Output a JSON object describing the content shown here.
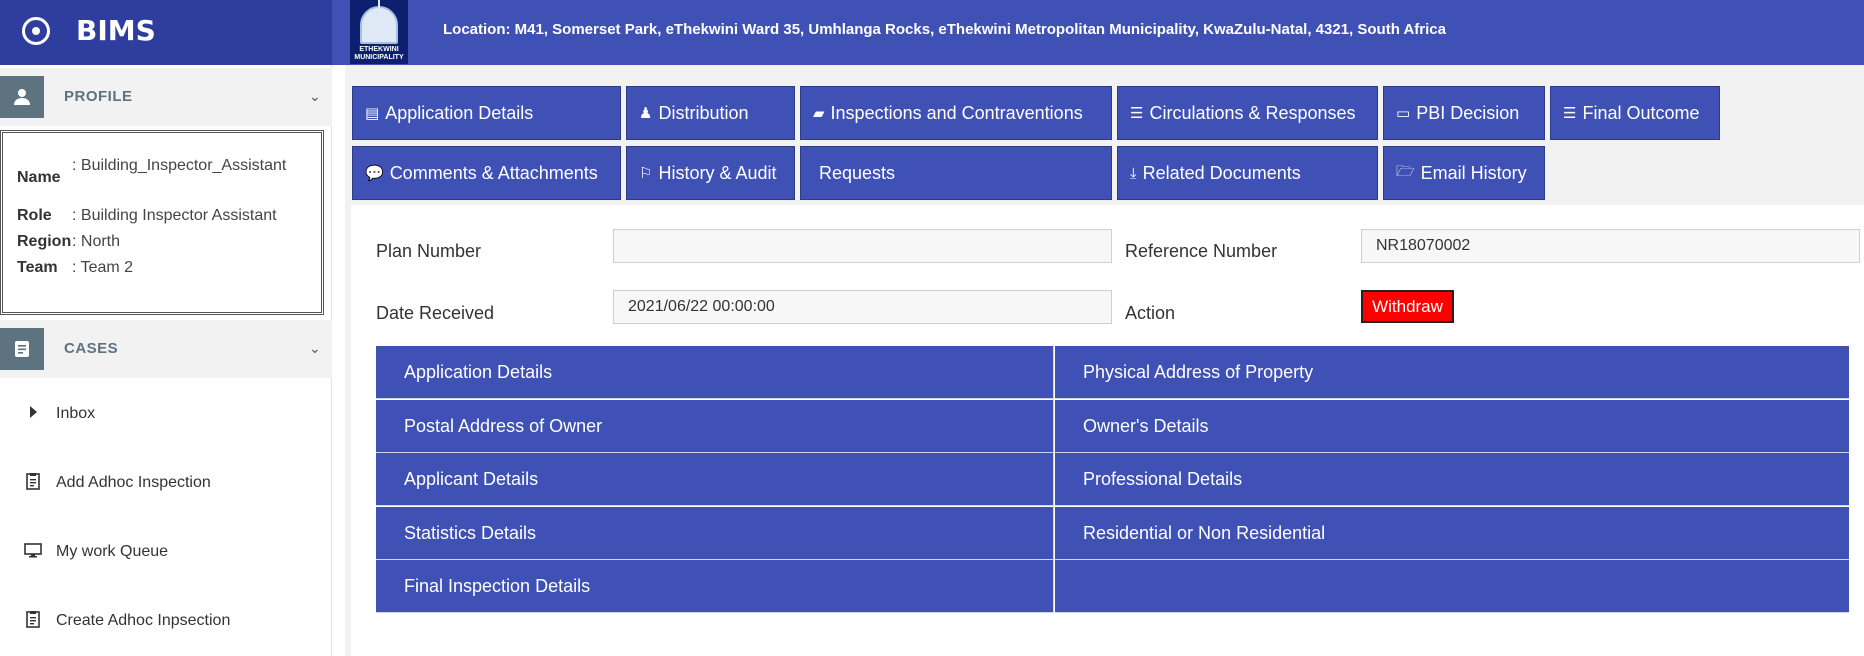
{
  "app": {
    "name": "BIMS"
  },
  "header": {
    "logo_text": "ETHEKWINI MUNICIPALITY",
    "location": "Location: M41, Somerset Park, eThekwini Ward 35, Umhlanga Rocks, eThekwini Metropolitan Municipality, KwaZulu-Natal, 4321, South Africa"
  },
  "sidebar": {
    "profile_title": "PROFILE",
    "profile": {
      "name_key": "Name",
      "name_val": ": Building_Inspector_Assistant",
      "role_key": "Role",
      "role_val": ": Building Inspector Assistant",
      "region_key": "Region",
      "region_val": ": North",
      "team_key": "Team",
      "team_val": ": Team 2"
    },
    "cases_title": "CASES",
    "items": [
      {
        "label": "Inbox",
        "icon": "caret-right-icon"
      },
      {
        "label": "Add Adhoc Inspection",
        "icon": "clipboard-icon"
      },
      {
        "label": "My work Queue",
        "icon": "monitor-icon"
      },
      {
        "label": "Create Adhoc Inpsection",
        "icon": "clipboard-icon"
      }
    ]
  },
  "tabs": [
    {
      "label": "Application Details",
      "icon": "id-card-icon",
      "glyph": "▤"
    },
    {
      "label": "Distribution",
      "icon": "user-icon",
      "glyph": "♟"
    },
    {
      "label": "Inspections and Contraventions",
      "icon": "book-icon",
      "glyph": "▰"
    },
    {
      "label": "Circulations & Responses",
      "icon": "list-icon",
      "glyph": "☰"
    },
    {
      "label": "PBI Decision",
      "icon": "desktop-icon",
      "glyph": "▭"
    },
    {
      "label": "Final Outcome",
      "icon": "list-icon",
      "glyph": "☰"
    },
    {
      "label": "Comments & Attachments",
      "icon": "comments-icon",
      "glyph": "💬"
    },
    {
      "label": "History & Audit",
      "icon": "bookmark-icon",
      "glyph": "⚐"
    },
    {
      "label": "Requests",
      "icon": "",
      "glyph": ""
    },
    {
      "label": "Related Documents",
      "icon": "download-icon",
      "glyph": "⤓"
    },
    {
      "label": "Email History",
      "icon": "folder-open-icon",
      "glyph": "🗁"
    }
  ],
  "form": {
    "plan_number_label": "Plan Number",
    "plan_number_value": "",
    "reference_number_label": "Reference Number",
    "reference_number_value": "NR18070002",
    "date_received_label": "Date Received",
    "date_received_value": "2021/06/22 00:00:00",
    "action_label": "Action",
    "withdraw_label": "Withdraw"
  },
  "sections": [
    "Application Details",
    "Physical Address of Property",
    "Postal Address of Owner",
    "Owner's Details",
    "Applicant Details",
    "Professional Details",
    "Statistics Details",
    "Residential or Non Residential",
    "Final Inspection Details",
    ""
  ],
  "colors": {
    "primary": "#3f51b5",
    "sidebar_header": "#2f3e9e",
    "accent_gray": "#5d7480",
    "withdraw": "#ff0000"
  }
}
